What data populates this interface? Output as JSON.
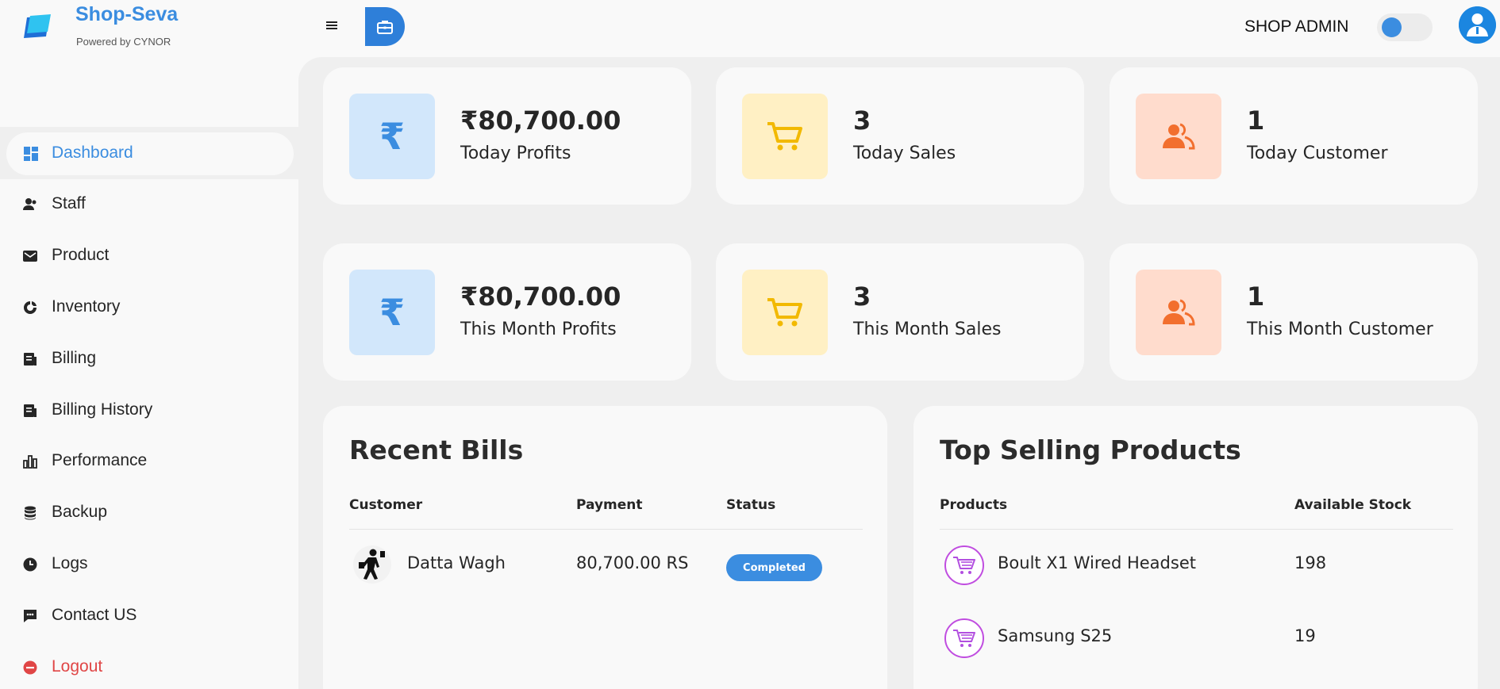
{
  "header": {
    "brand_name": "Shop-Seva",
    "brand_sub": "Powered by CYNOR",
    "role": "SHOP ADMIN"
  },
  "sidebar": {
    "items": [
      {
        "label": "Dashboard",
        "icon": "dashboard-icon"
      },
      {
        "label": "Staff",
        "icon": "staff-icon"
      },
      {
        "label": "Product",
        "icon": "product-icon"
      },
      {
        "label": "Inventory",
        "icon": "inventory-icon"
      },
      {
        "label": "Billing",
        "icon": "billing-icon"
      },
      {
        "label": "Billing History",
        "icon": "billing-history-icon"
      },
      {
        "label": "Performance",
        "icon": "performance-icon"
      },
      {
        "label": "Backup",
        "icon": "backup-icon"
      },
      {
        "label": "Logs",
        "icon": "logs-icon"
      },
      {
        "label": "Contact US",
        "icon": "contact-icon"
      },
      {
        "label": "Logout",
        "icon": "logout-icon"
      }
    ]
  },
  "stats": [
    {
      "value": "₹80,700.00",
      "label": "Today Profits",
      "icon": "rupee-icon"
    },
    {
      "value": "3",
      "label": "Today Sales",
      "icon": "cart-icon"
    },
    {
      "value": "1",
      "label": "Today Customer",
      "icon": "customers-icon"
    },
    {
      "value": "₹80,700.00",
      "label": "This Month Profits",
      "icon": "rupee-icon"
    },
    {
      "value": "3",
      "label": "This Month Sales",
      "icon": "cart-icon"
    },
    {
      "value": "1",
      "label": "This Month Customer",
      "icon": "customers-icon"
    }
  ],
  "recent_bills": {
    "title": "Recent Bills",
    "columns": [
      "Customer",
      "Payment",
      "Status"
    ],
    "rows": [
      {
        "customer": "Datta Wagh",
        "payment": "80,700.00 RS",
        "status": "Completed"
      }
    ]
  },
  "top_products": {
    "title": "Top Selling Products",
    "columns": [
      "Products",
      "Available Stock"
    ],
    "rows": [
      {
        "product": "Boult X1 Wired Headset",
        "stock": "198"
      },
      {
        "product": "Samsung S25",
        "stock": "19"
      }
    ]
  },
  "colors": {
    "accent": "#3b8de0",
    "logout": "#e04646",
    "profit_box": "#d2e7fb",
    "sales_box": "#fff0c4",
    "customer_box": "#ffdccd"
  }
}
